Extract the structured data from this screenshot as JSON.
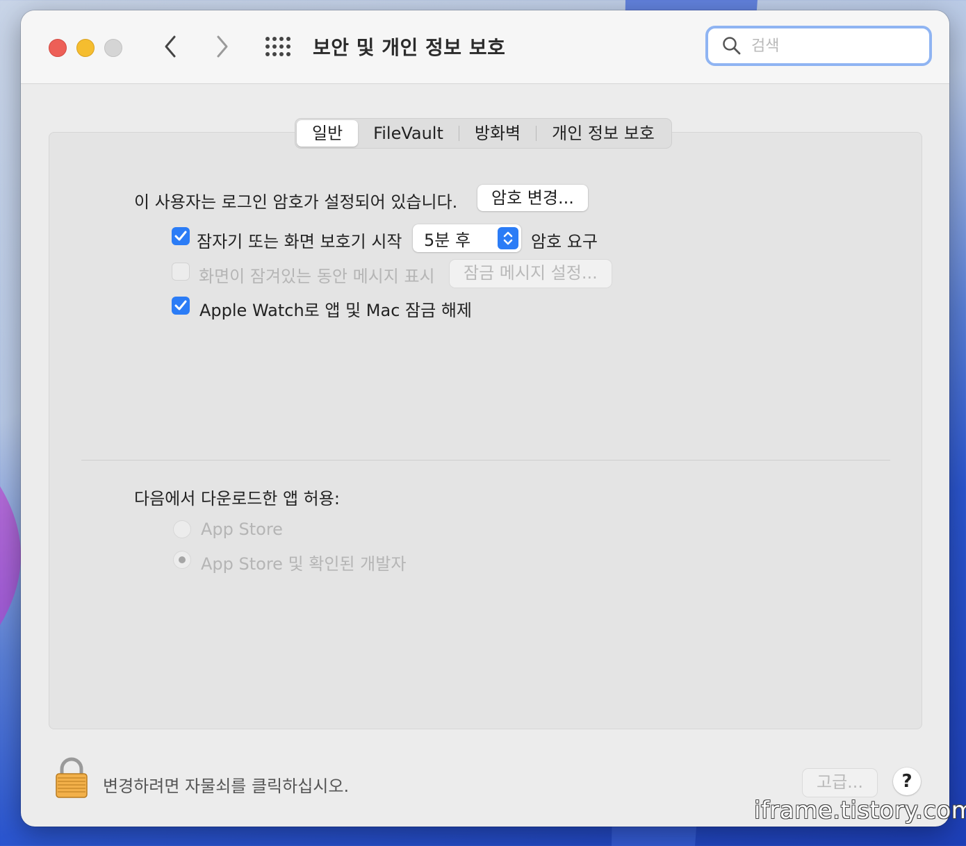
{
  "window": {
    "title": "보안 및 개인 정보 보호"
  },
  "search": {
    "placeholder": "검색"
  },
  "tabs": [
    {
      "label": "일반",
      "active": true
    },
    {
      "label": "FileVault",
      "active": false
    },
    {
      "label": "방화벽",
      "active": false
    },
    {
      "label": "개인 정보 보호",
      "active": false
    }
  ],
  "general": {
    "password_status": "이 사용자는 로그인 암호가 설정되어 있습니다.",
    "change_password_button": "암호 변경...",
    "require_password": {
      "checked": true,
      "label": "잠자기 또는 화면 보호기 시작",
      "delay_value": "5분 후",
      "suffix": "암호 요구"
    },
    "lock_message": {
      "checked": false,
      "enabled": false,
      "label": "화면이 잠겨있는 동안 메시지 표시",
      "button": "잠금 메시지 설정..."
    },
    "apple_watch": {
      "checked": true,
      "label": "Apple Watch로 앱 및 Mac 잠금 해제"
    }
  },
  "downloads": {
    "heading": "다음에서 다운로드한 앱 허용:",
    "options": [
      {
        "label": "App Store",
        "selected": false
      },
      {
        "label": "App Store 및 확인된 개발자",
        "selected": true
      }
    ]
  },
  "footer": {
    "lock_text": "변경하려면 자물쇠를 클릭하십시오.",
    "advanced_button": "고급...",
    "help_button": "?"
  },
  "watermark": "iframe.tistory.com",
  "colors": {
    "accent": "#2b7cf6",
    "search_ring": "#8fb4f2",
    "close": "#ed5f57",
    "minimize": "#f5bd2f"
  }
}
